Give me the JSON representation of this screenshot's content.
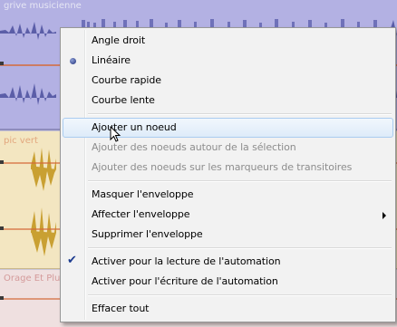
{
  "tracks": {
    "grive": {
      "name": "grive musicienne"
    },
    "pic": {
      "name": "pic vert"
    },
    "orage": {
      "name": "Orage Et Plu"
    }
  },
  "menu": {
    "items": [
      {
        "label": "Angle droit",
        "enabled": true,
        "marker": "none"
      },
      {
        "label": "Linéaire",
        "enabled": true,
        "marker": "radio-bullet"
      },
      {
        "label": "Courbe rapide",
        "enabled": true,
        "marker": "none"
      },
      {
        "label": "Courbe lente",
        "enabled": true,
        "marker": "none"
      },
      {
        "label": "Ajouter un noeud",
        "enabled": true,
        "marker": "none",
        "hovered": true
      },
      {
        "label": "Ajouter des noeuds autour de la sélection",
        "enabled": false,
        "marker": "none"
      },
      {
        "label": "Ajouter des noeuds sur les marqueurs de transitoires",
        "enabled": false,
        "marker": "none"
      },
      {
        "label": "Masquer l'enveloppe",
        "enabled": true,
        "marker": "none"
      },
      {
        "label": "Affecter l'enveloppe",
        "enabled": true,
        "marker": "none",
        "submenu": true
      },
      {
        "label": "Supprimer l'enveloppe",
        "enabled": true,
        "marker": "none"
      },
      {
        "label": "Activer pour la lecture de l'automation",
        "enabled": true,
        "marker": "check"
      },
      {
        "label": "Activer pour l'écriture de l'automation",
        "enabled": true,
        "marker": "none"
      },
      {
        "label": "Effacer tout",
        "enabled": true,
        "marker": "none"
      }
    ]
  },
  "colors": {
    "grive_track": "#b3b1e3",
    "pic_track": "#f3e6c1",
    "orage_track": "#efe0e0",
    "grive_wave": "#5b5ea8",
    "pic_wave": "#c9a032",
    "envelope": "#d46a3a",
    "hover_border": "#aaccf0"
  }
}
